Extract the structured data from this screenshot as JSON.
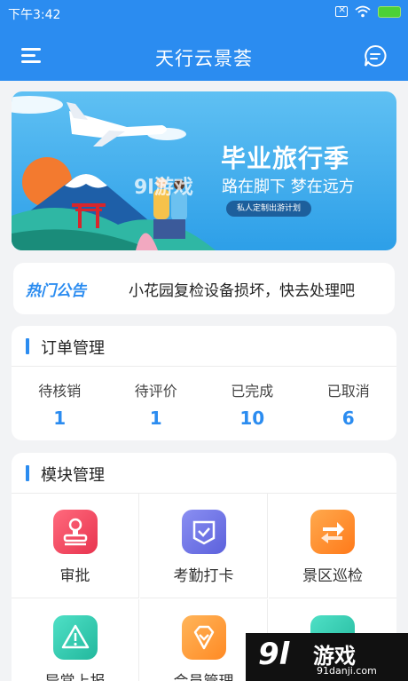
{
  "status_bar": {
    "time": "下午3:42"
  },
  "navbar": {
    "title": "天行云景荟",
    "menu_icon": "menu-icon",
    "message_icon": "message-icon"
  },
  "banner": {
    "title": "毕业旅行季",
    "subtitle": "路在脚下 梦在远方",
    "pill": "私人定制出游计划",
    "watermark": "9l游戏"
  },
  "notice": {
    "tag": "热门公告",
    "text": "小花园复检设备损坏，快去处理吧"
  },
  "orders": {
    "title": "订单管理",
    "stats": [
      {
        "label": "待核销",
        "value": "1"
      },
      {
        "label": "待评价",
        "value": "1"
      },
      {
        "label": "已完成",
        "value": "10"
      },
      {
        "label": "已取消",
        "value": "6"
      }
    ]
  },
  "modules": {
    "title": "模块管理",
    "items": [
      {
        "label": "审批",
        "icon": "stamp-icon",
        "color": "#f0455d"
      },
      {
        "label": "考勤打卡",
        "icon": "check-badge-icon",
        "color": "#6e74e8"
      },
      {
        "label": "景区巡检",
        "icon": "swap-arrows-icon",
        "color": "#ff8f2d"
      },
      {
        "label": "异常上报",
        "icon": "warning-icon",
        "color": "#2fc9b0"
      },
      {
        "label": "会员管理",
        "icon": "diamond-icon",
        "color": "#ff9a3c"
      },
      {
        "label": "",
        "icon": "partial-icon",
        "color": "#2fc9b0"
      }
    ]
  },
  "watermark": {
    "logo": "9l",
    "name": "游戏",
    "site": "91danji.com"
  },
  "colors": {
    "primary": "#2b8cf0",
    "background": "#f2f3f5"
  }
}
